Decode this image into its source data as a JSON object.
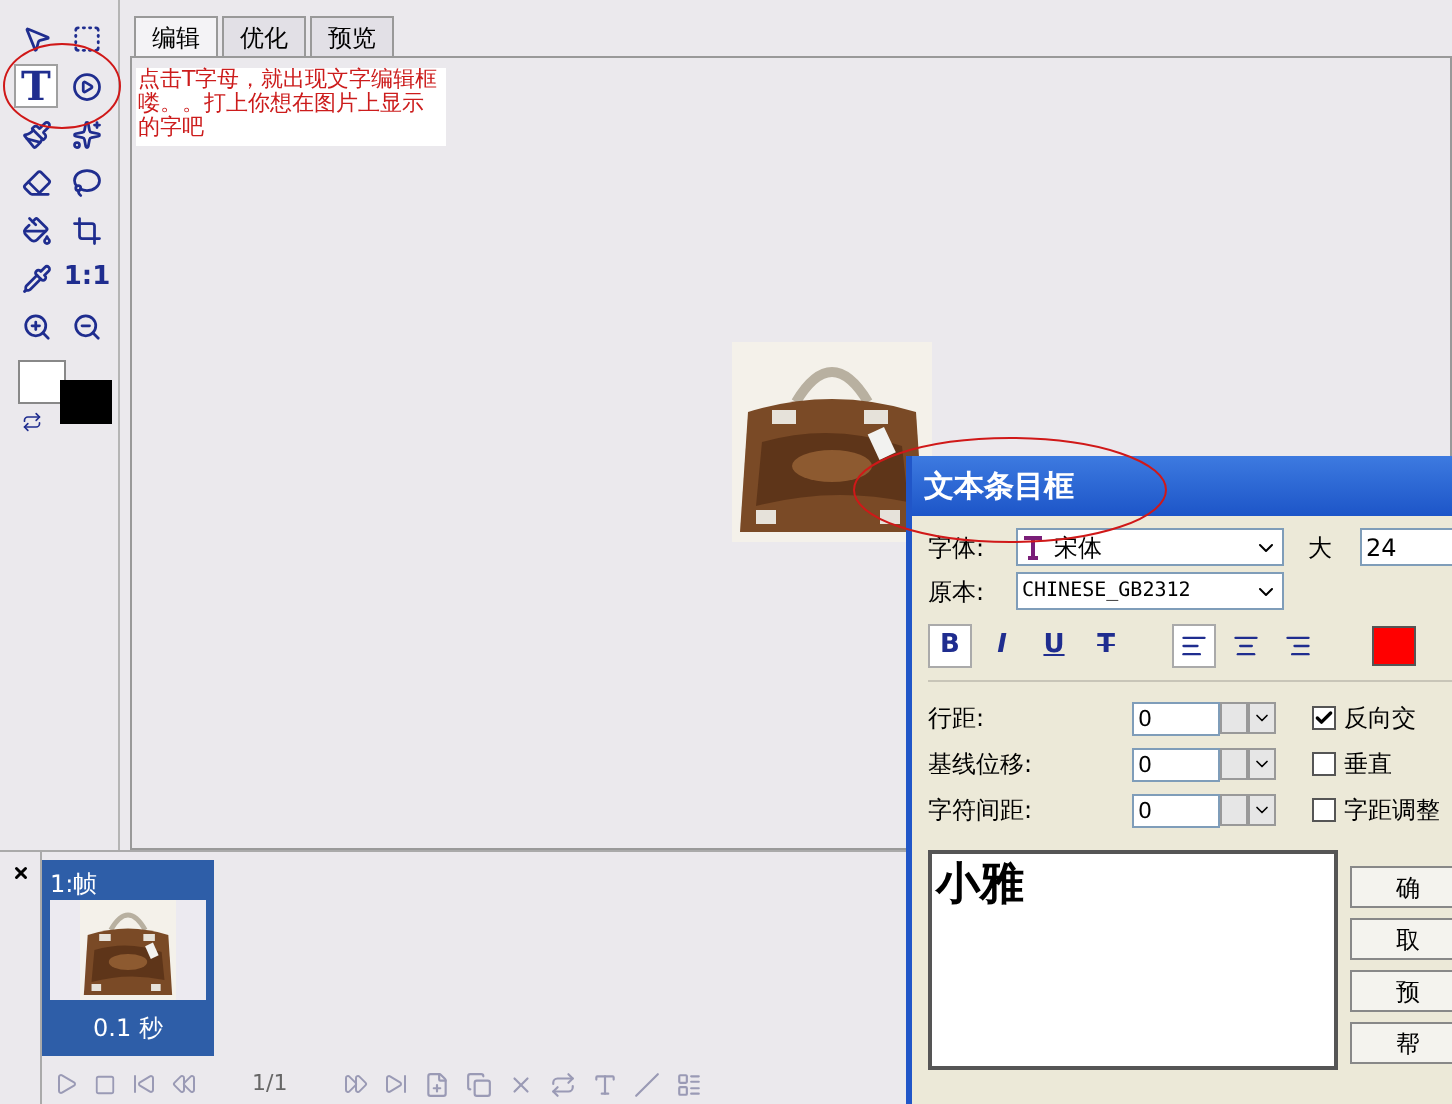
{
  "tools": [
    {
      "kind": "move",
      "selected": false
    },
    {
      "kind": "slice-select",
      "selected": false
    },
    {
      "kind": "text",
      "label": "T",
      "selected": true
    },
    {
      "kind": "play",
      "selected": false
    },
    {
      "kind": "brush",
      "selected": false
    },
    {
      "kind": "magic",
      "selected": false
    },
    {
      "kind": "eraser",
      "selected": false
    },
    {
      "kind": "lasso",
      "selected": false
    },
    {
      "kind": "bucket",
      "selected": false
    },
    {
      "kind": "crop",
      "selected": false
    },
    {
      "kind": "dropper",
      "selected": false
    },
    {
      "kind": "ratio",
      "label": "1:1",
      "selected": false
    },
    {
      "kind": "zoom-in",
      "selected": false
    },
    {
      "kind": "zoom-out",
      "selected": false
    }
  ],
  "tabs": [
    {
      "label": "编辑",
      "selected": true
    },
    {
      "label": "优化",
      "selected": false
    },
    {
      "label": "预览",
      "selected": false
    }
  ],
  "note": "点击T字母，就出现文字编辑框喽。。打上你想在图片上显示的字吧",
  "frames": [
    {
      "label": "1:帧",
      "delay": "0.1 秒",
      "selected": true
    }
  ],
  "frame_counter": "1/1",
  "dialog": {
    "title": "文本条目框",
    "font_label": "字体:",
    "font": "宋体",
    "size_label": "大",
    "size": "24",
    "script_label": "原本:",
    "script": "CHINESE_GB2312",
    "styles": [
      {
        "kind": "bold",
        "label": "B",
        "selected": true
      },
      {
        "kind": "italic",
        "label": "I",
        "selected": false
      },
      {
        "kind": "underline",
        "label": "U",
        "selected": false
      },
      {
        "kind": "strike",
        "label": "T",
        "selected": false
      }
    ],
    "aligns": [
      {
        "kind": "left",
        "selected": true
      },
      {
        "kind": "center",
        "selected": false
      },
      {
        "kind": "right",
        "selected": false
      }
    ],
    "color": "#ff0000",
    "fields": [
      {
        "label": "行距:",
        "value": "0"
      },
      {
        "label": "基线位移:",
        "value": "0"
      },
      {
        "label": "字符间距:",
        "value": "0"
      }
    ],
    "options": [
      {
        "label": "反向交",
        "checked": true
      },
      {
        "label": "垂直",
        "checked": false
      },
      {
        "label": "字距调整",
        "checked": false
      }
    ],
    "text": "小雅",
    "buttons": [
      "确",
      "取",
      "预",
      "帮"
    ]
  }
}
